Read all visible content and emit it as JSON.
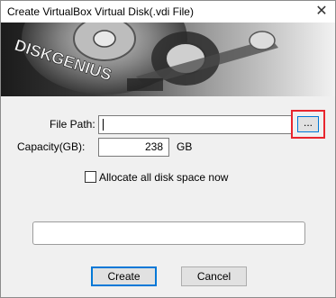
{
  "window": {
    "title": "Create VirtualBox Virtual Disk(.vdi File)",
    "close_glyph": "✕"
  },
  "banner": {
    "logo_text": "DISKGENIUS"
  },
  "form": {
    "file_path_label": "File Path:",
    "file_path_value": "",
    "browse_label": "...",
    "capacity_label": "Capacity(GB):",
    "capacity_value": "238",
    "capacity_unit": "GB",
    "allocate_label": "Allocate all disk space now",
    "allocate_checked": false
  },
  "progress": {
    "value": 0
  },
  "buttons": {
    "create": "Create",
    "cancel": "Cancel"
  },
  "colors": {
    "highlight": "#e8262e",
    "focus": "#0078d7",
    "progress_fill": "#06b025"
  },
  "icons": {
    "close": "close-icon",
    "banner": "hard-disk-image"
  }
}
